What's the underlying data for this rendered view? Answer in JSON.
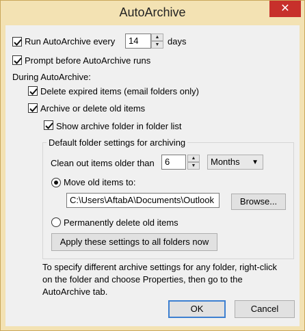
{
  "window": {
    "title": "AutoArchive",
    "close_glyph": "✕"
  },
  "run_every": {
    "checked": true,
    "label": "Run AutoArchive every",
    "value": "14",
    "unit": "days"
  },
  "prompt_before": {
    "checked": true,
    "label": "Prompt before AutoArchive runs"
  },
  "during_label": "During AutoArchive:",
  "delete_expired": {
    "checked": true,
    "label": "Delete expired items (email folders only)"
  },
  "archive_old": {
    "checked": true,
    "label": "Archive or delete old items"
  },
  "show_folder": {
    "checked": true,
    "label": "Show archive folder in folder list"
  },
  "defaults_group": {
    "title": "Default folder settings for archiving",
    "clean_out_label": "Clean out items older than",
    "clean_out_value": "6",
    "period": "Months",
    "move_radio_label": "Move old items to:",
    "move_selected": true,
    "path_value": "C:\\Users\\AftabA\\Documents\\Outlook",
    "browse_label": "Browse...",
    "delete_radio_label": "Permanently delete old items",
    "apply_label": "Apply these settings to all folders now"
  },
  "info_text": "To specify different archive settings for any folder, right-click on the folder and choose Properties, then go to the AutoArchive tab.",
  "buttons": {
    "ok": "OK",
    "cancel": "Cancel"
  },
  "colors": {
    "frame": "#f3e2b3",
    "close": "#c7302b",
    "client": "#f0f0f0"
  }
}
